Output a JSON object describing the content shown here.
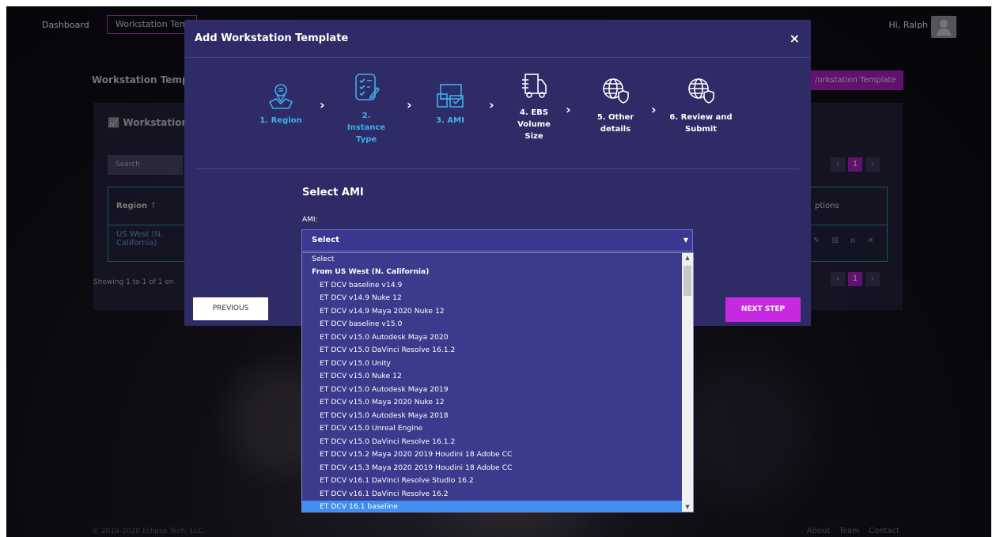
{
  "nav": {
    "dashboard": "Dashboard",
    "active": "Workstation Tem",
    "greeting": "Hi, Ralph"
  },
  "background": {
    "page_title": "Workstation Templ",
    "add_button": "/orkstation Template",
    "panel_title": "Workstation",
    "search_placeholder": "Search",
    "col_region": "Region",
    "col_actions": "ptions",
    "row_region": "US West (N. California)",
    "showing": "Showing 1 to 1 of 1 en",
    "page_number": "1",
    "copyright": "© 2019-2020 Eclipse Tech, LLC.",
    "footer_links": "About Team Contact"
  },
  "modal": {
    "title": "Add Workstation Template",
    "close": "×",
    "steps": [
      {
        "label": "1. Region",
        "status": "done",
        "icon": "region-map-icon"
      },
      {
        "label": "2. Instance Type",
        "status": "done",
        "icon": "checklist-icon"
      },
      {
        "label": "3. AMI",
        "status": "done",
        "icon": "ami-devices-icon"
      },
      {
        "label": "4. EBS Volume Size",
        "status": "pending",
        "icon": "truck-icon"
      },
      {
        "label": "5. Other details",
        "status": "pending",
        "icon": "globe-shield-icon"
      },
      {
        "label": "6. Review and Submit",
        "status": "pending",
        "icon": "globe-shield-icon"
      }
    ],
    "section_title": "Select AMI",
    "ami_label": "AMI:",
    "ami_value": "Select",
    "prev_button": "PREVIOUS",
    "next_button": "NEXT STEP"
  },
  "dropdown": {
    "placeholder_option": "Select",
    "group": "From US West (N. California)",
    "options": [
      "ET DCV baseline v14.9",
      "ET DCV v14.9 Nuke 12",
      "ET DCV v14.9 Maya 2020 Nuke 12",
      "ET DCV baseline v15.0",
      "ET DCV v15.0 Autodesk Maya 2020",
      "ET DCV v15.0 DaVinci Resolve 16.1.2",
      "ET DCV v15.0 Unity",
      "ET DCV v15.0 Nuke 12",
      "ET DCV v15.0 Autodesk Maya 2019",
      "ET DCV v15.0 Maya 2020 Nuke 12",
      "ET DCV v15.0 Autodesk Maya 2018",
      "ET DCV v15.0 Unreal Engine",
      "ET DCV v15.0 DaVinci Resolve 16.1.2",
      "ET DCV v15.2 Maya 2020 2019 Houdini 18 Adobe CC",
      "ET DCV v15.3 Maya 2020 2019 Houdini 18 Adobe CC",
      "ET DCV v16.1 DaVinci Resolve Studio 16.2",
      "ET DCV v16.1 DaVinci Resolve 16.2",
      "ET DCV 16.1 baseline"
    ],
    "highlighted": "ET DCV 16.1 baseline"
  },
  "colors": {
    "modal_bg": "#2f2b66",
    "accent": "#c52ae0",
    "step_done": "#3db0ea",
    "highlight": "#3f8ef0"
  }
}
